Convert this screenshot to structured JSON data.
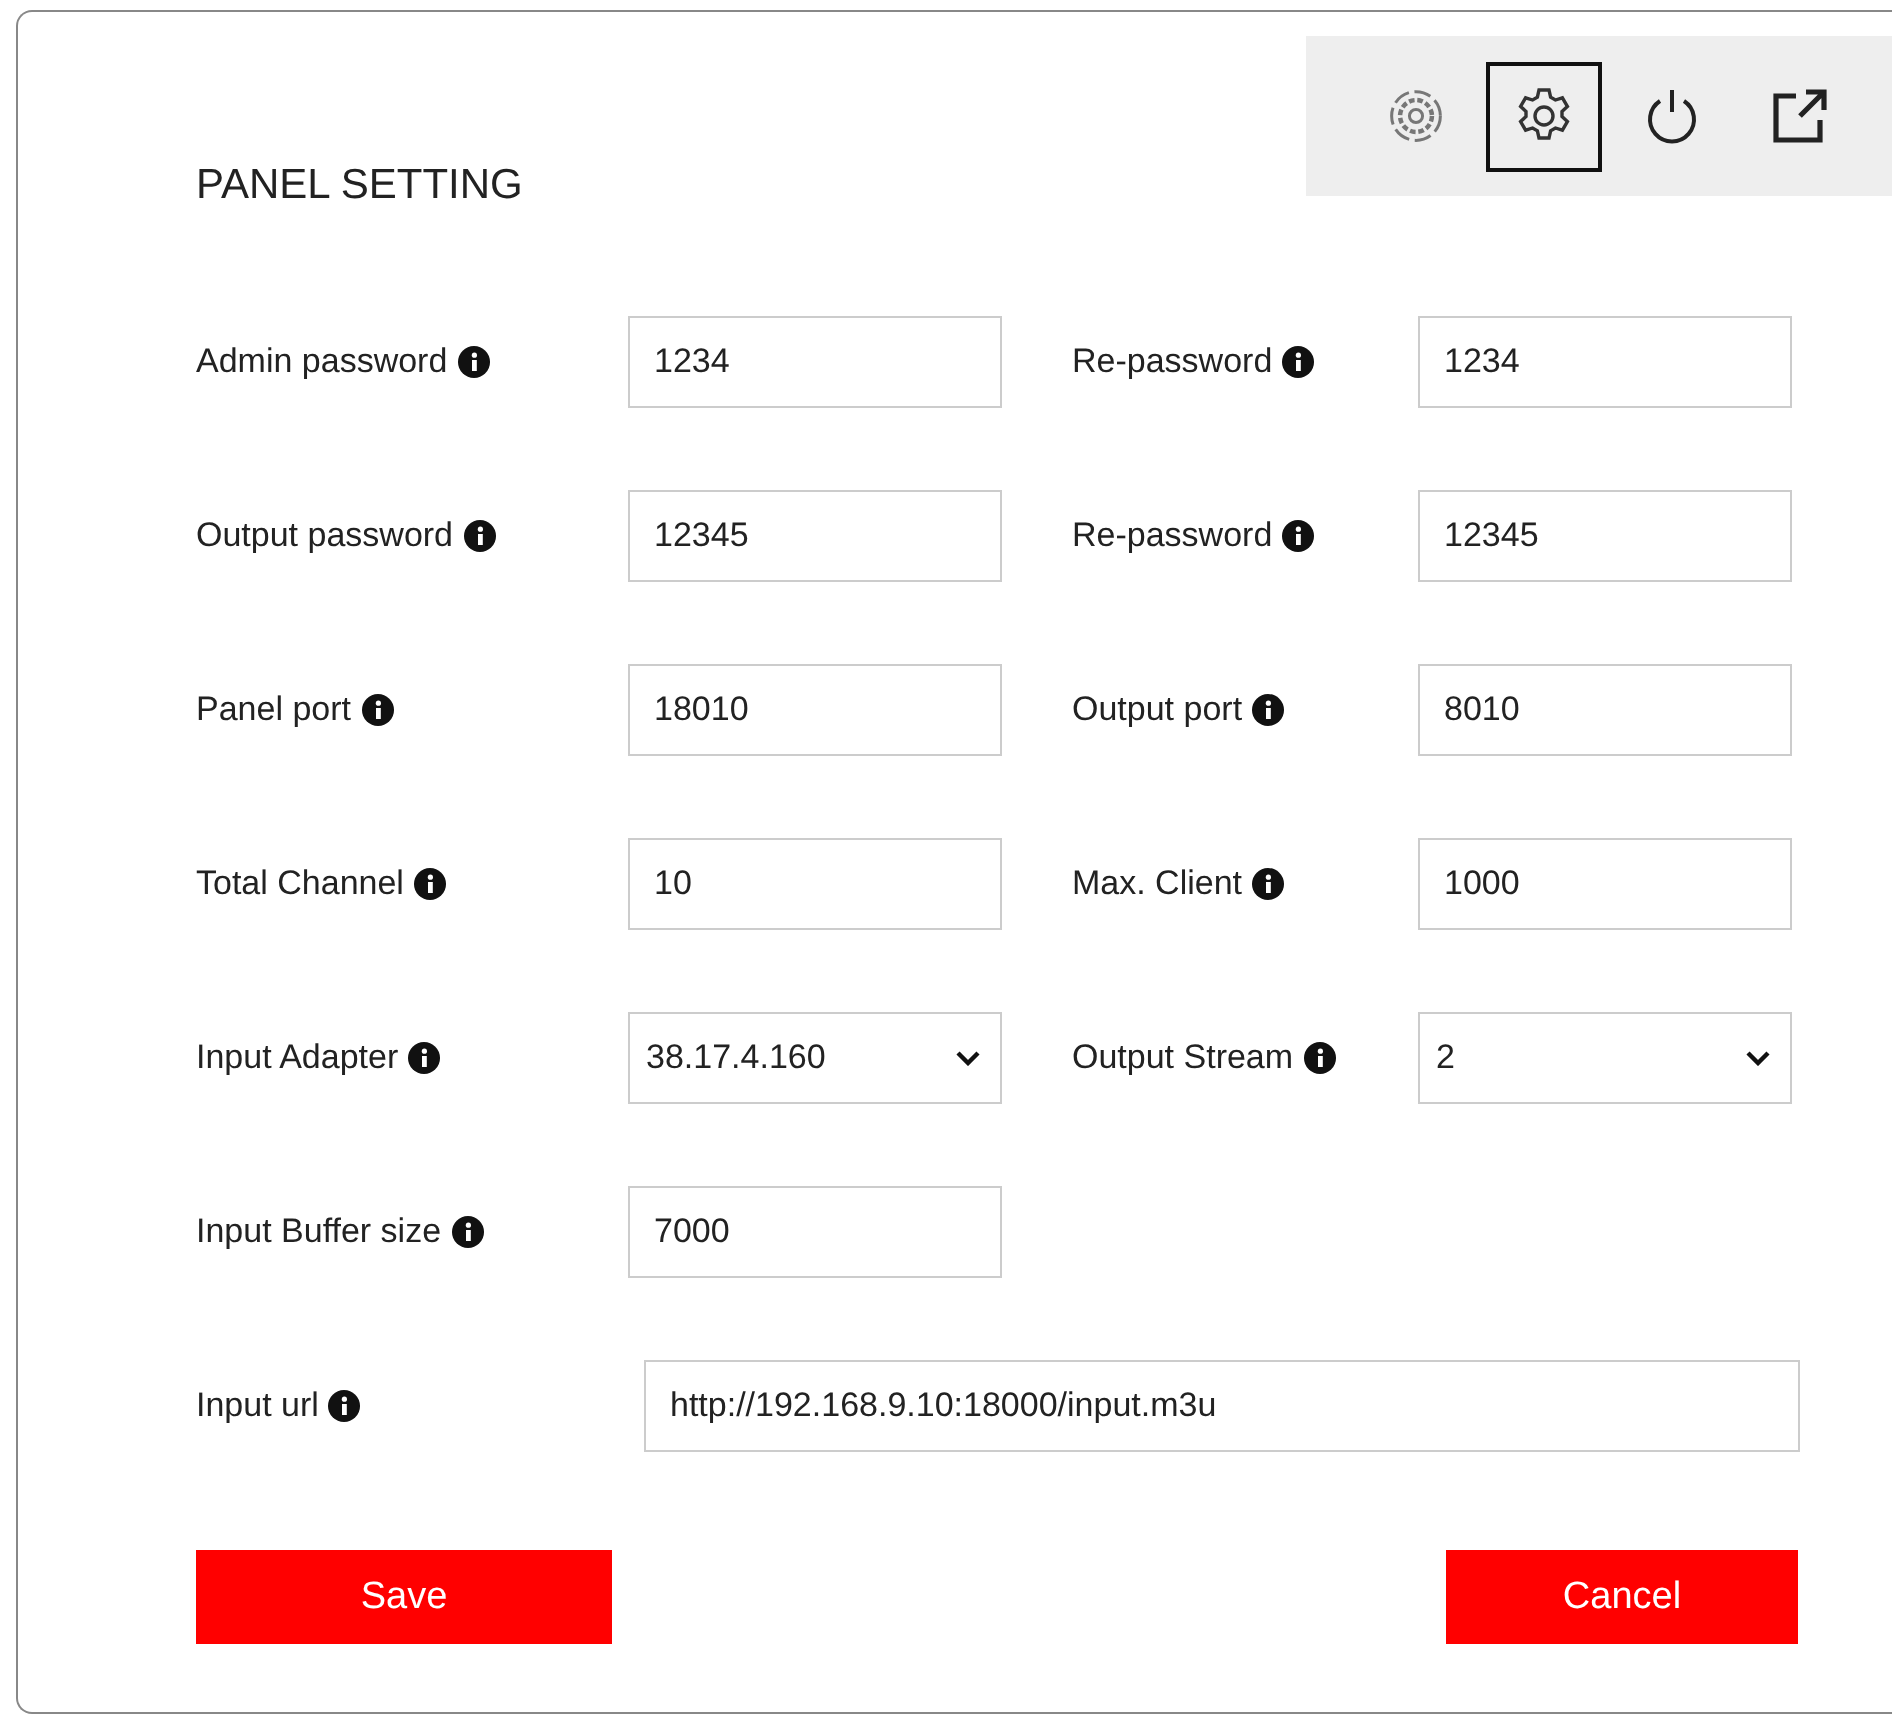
{
  "toolbar": [
    {
      "kind": "target-gear",
      "selected": false
    },
    {
      "kind": "gear",
      "selected": true
    },
    {
      "kind": "power",
      "selected": false
    },
    {
      "kind": "external",
      "selected": false
    }
  ],
  "title": "PANEL SETTING",
  "rows": [
    [
      {
        "label": "Admin password",
        "kind": "text",
        "value": "1234"
      },
      {
        "label": "Re-password",
        "kind": "text",
        "value": "1234"
      }
    ],
    [
      {
        "label": "Output password",
        "kind": "text",
        "value": "12345"
      },
      {
        "label": "Re-password",
        "kind": "text",
        "value": "12345"
      }
    ],
    [
      {
        "label": "Panel port",
        "kind": "text",
        "value": "18010"
      },
      {
        "label": "Output port",
        "kind": "text",
        "value": "8010"
      }
    ],
    [
      {
        "label": "Total Channel",
        "kind": "text",
        "value": "10"
      },
      {
        "label": "Max. Client",
        "kind": "text",
        "value": "1000"
      }
    ],
    [
      {
        "label": "Input Adapter",
        "kind": "select",
        "value": "38.17.4.160"
      },
      {
        "label": "Output Stream",
        "kind": "select",
        "value": "2"
      }
    ],
    [
      {
        "label": "Input Buffer size",
        "kind": "text",
        "value": "7000"
      }
    ]
  ],
  "url": {
    "label": "Input url",
    "value": "http://192.168.9.10:18000/input.m3u"
  },
  "buttons": {
    "save": "Save",
    "cancel": "Cancel"
  }
}
